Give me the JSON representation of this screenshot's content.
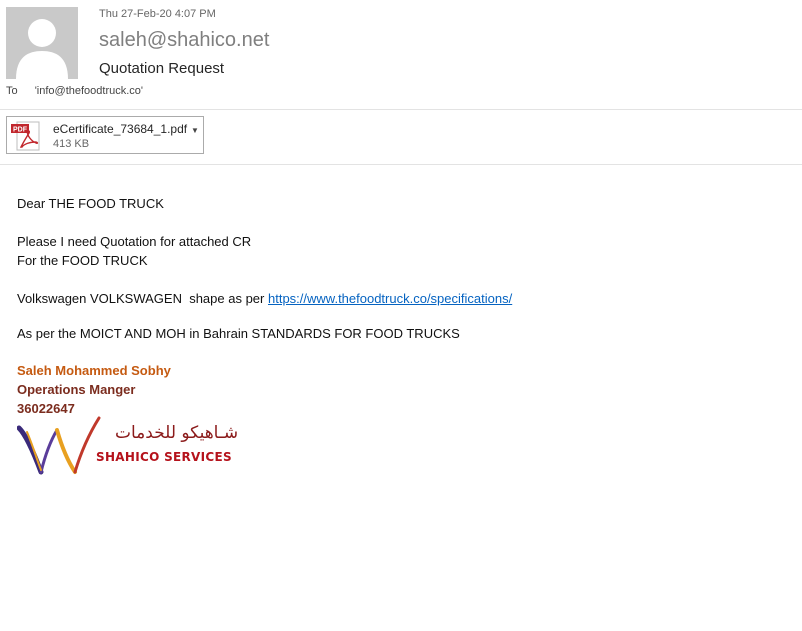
{
  "message": {
    "date": "Thu 27-Feb-20 4:07 PM",
    "sender": "saleh@shahico.net",
    "subject": "Quotation Request",
    "to_label": "To",
    "to_value": "'info@thefoodtruck.co'"
  },
  "attachment": {
    "icon_badge": "PDF",
    "name": "eCertificate_73684_1.pdf",
    "size": "413 KB"
  },
  "body": {
    "greeting": "Dear THE FOOD TRUCK",
    "line1": "Please I need Quotation for attached CR",
    "line2": "For the FOOD TRUCK",
    "line3_prefix": "Volkswagen VOLKSWAGEN  shape as per ",
    "line3_link": "https://www.thefoodtruck.co/specifications/",
    "line4": "As per the MOICT AND MOH in Bahrain STANDARDS FOR FOOD TRUCKS"
  },
  "signature": {
    "name": "Saleh Mohammed Sobhy",
    "title": "Operations Manger",
    "phone": "36022647",
    "logo_arabic": "شـاهيكو للخدمات",
    "logo_english": "SHAHICO SERVICES"
  },
  "colors": {
    "link": "#0563c1",
    "signature_name": "#c55a11",
    "signature_dark": "#7b2c1e",
    "logo_red": "#b5121b"
  }
}
